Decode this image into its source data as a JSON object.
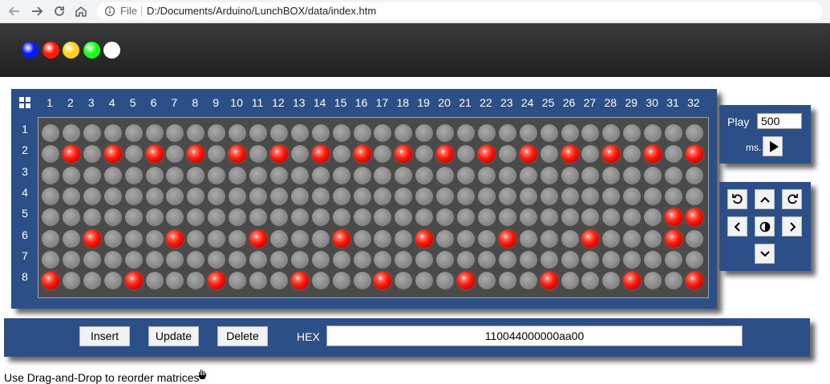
{
  "browser": {
    "back_icon": "back-arrow-icon",
    "forward_icon": "forward-arrow-icon",
    "reload_icon": "reload-icon",
    "home_icon": "home-icon",
    "info_icon": "info-icon",
    "scheme_label": "File",
    "url": "D:/Documents/Arduino/LunchBOX/data/index.htm"
  },
  "palette": {
    "colors": [
      "#0a1aff",
      "#ff1a0a",
      "#ffd21a",
      "#1aff1a",
      "#ffffff"
    ],
    "names": [
      "blue",
      "red",
      "yellow",
      "green",
      "white"
    ]
  },
  "matrix": {
    "columns": [
      "1",
      "2",
      "3",
      "4",
      "5",
      "6",
      "7",
      "8",
      "9",
      "10",
      "11",
      "12",
      "13",
      "14",
      "15",
      "16",
      "17",
      "18",
      "19",
      "20",
      "21",
      "22",
      "23",
      "24",
      "25",
      "26",
      "27",
      "28",
      "29",
      "30",
      "31",
      "32"
    ],
    "rows": [
      "1",
      "2",
      "3",
      "4",
      "5",
      "6",
      "7",
      "8"
    ],
    "lit": [
      "00000000000000000000000000000000",
      "01010101010101010101010101010101",
      "00000000000000000000000000000000",
      "00000000000000000000000000000000",
      "00000000000000000000000000000011",
      "00100010001000100010001000100010",
      "00000000000000000000000000000000",
      "10001000100010001000100010001001"
    ],
    "lit_color": "#ff1a0a",
    "unlit_color": "#8a8a8a"
  },
  "play": {
    "label": "Play",
    "interval_value": "500",
    "unit_label": "ms.",
    "play_icon": "play-icon"
  },
  "shift": {
    "icons": [
      "rotate-left-icon",
      "arrow-up-icon",
      "rotate-right-icon",
      "arrow-left-icon",
      "invert-icon",
      "arrow-right-icon",
      "arrow-down-icon"
    ]
  },
  "editor": {
    "insert_label": "Insert",
    "update_label": "Update",
    "delete_label": "Delete",
    "hex_label": "HEX",
    "hex_value": "110044000000aa00"
  },
  "footer": {
    "hint": "Use Drag-and-Drop to reorder matrices"
  }
}
